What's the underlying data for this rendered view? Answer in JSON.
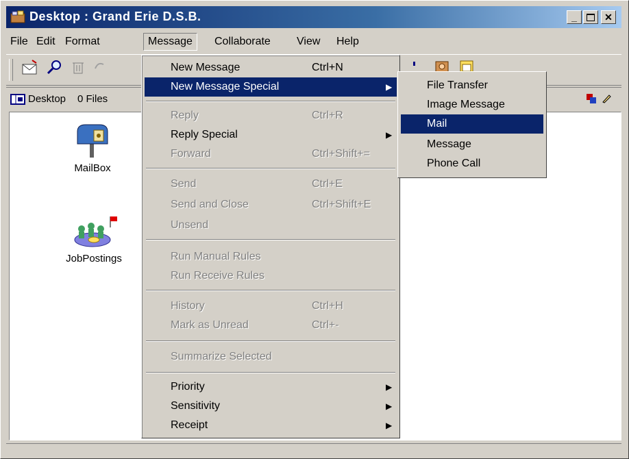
{
  "window": {
    "title": "Desktop : Grand Erie D.S.B."
  },
  "menubar": {
    "file": "File",
    "edit": "Edit",
    "format": "Format",
    "message": "Message",
    "collaborate": "Collaborate",
    "view": "View",
    "help": "Help"
  },
  "statusrow": {
    "location": "Desktop",
    "files": "0 Files"
  },
  "desktop": {
    "mailbox_label": "MailBox",
    "jobpostings_label": "JobPostings"
  },
  "message_menu": {
    "new_message": "New Message",
    "new_message_shortcut": "Ctrl+N",
    "new_message_special": "New Message Special",
    "reply": "Reply",
    "reply_shortcut": "Ctrl+R",
    "reply_special": "Reply Special",
    "forward": "Forward",
    "forward_shortcut": "Ctrl+Shift+=",
    "send": "Send",
    "send_shortcut": "Ctrl+E",
    "send_and_close": "Send and Close",
    "send_and_close_shortcut": "Ctrl+Shift+E",
    "unsend": "Unsend",
    "run_manual_rules": "Run Manual Rules",
    "run_receive_rules": "Run Receive Rules",
    "history": "History",
    "history_shortcut": "Ctrl+H",
    "mark_as_unread": "Mark as Unread",
    "mark_as_unread_shortcut": "Ctrl+-",
    "summarize_selected": "Summarize Selected",
    "priority": "Priority",
    "sensitivity": "Sensitivity",
    "receipt": "Receipt"
  },
  "submenu": {
    "file_transfer": "File Transfer",
    "image_message": "Image Message",
    "mail": "Mail",
    "message": "Message",
    "phone_call": "Phone Call"
  },
  "colors": {
    "highlight": "#0a246a",
    "chrome": "#d4d0c8"
  }
}
